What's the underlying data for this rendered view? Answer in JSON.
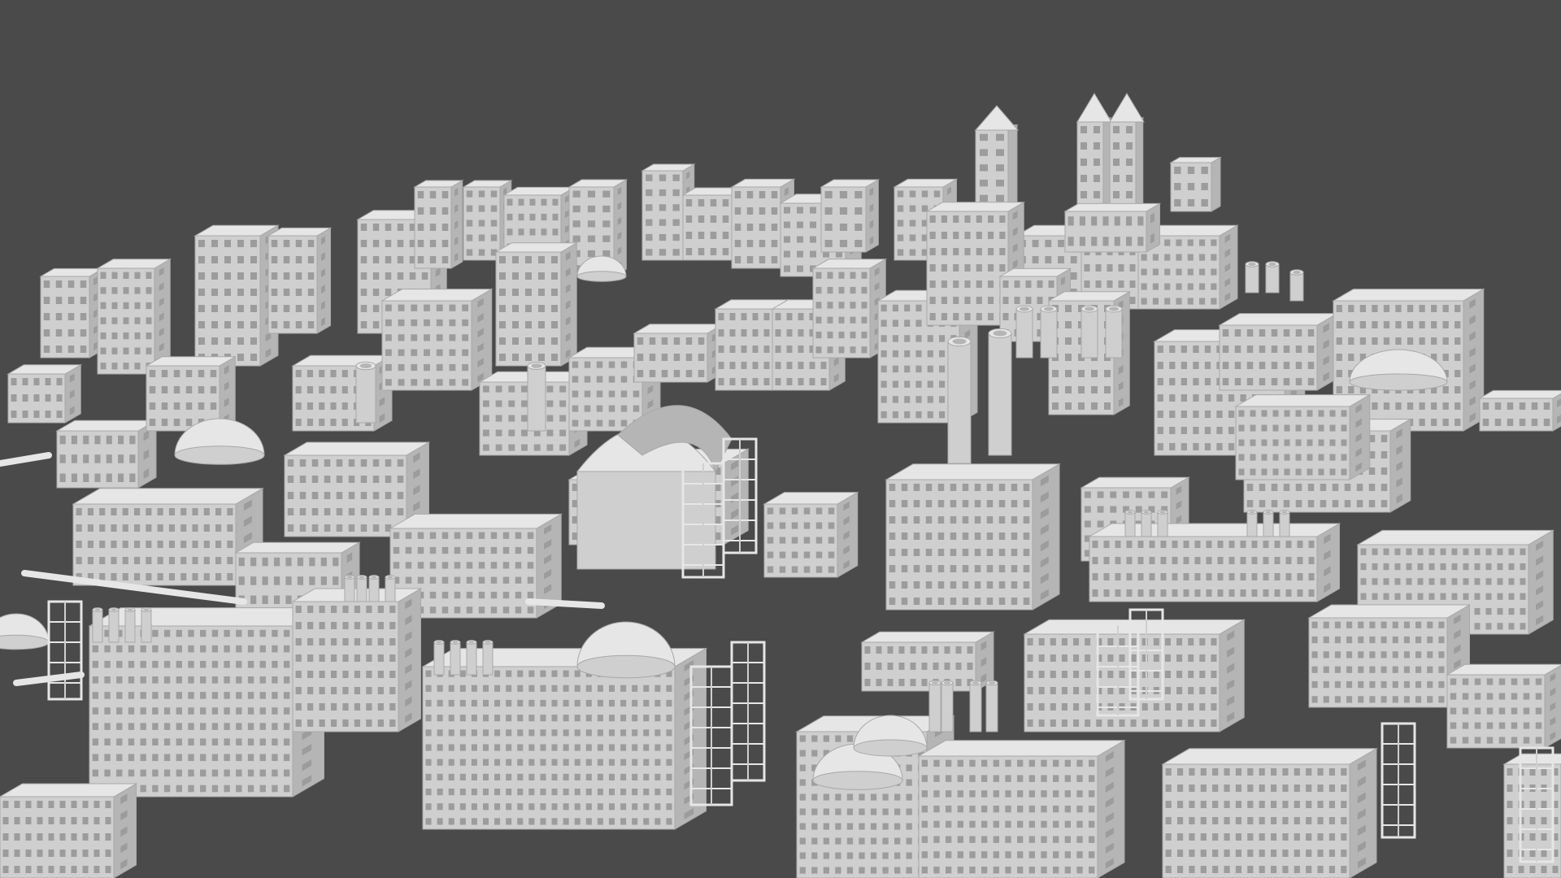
{
  "scene": {
    "subject": "city-model-render",
    "colors": {
      "background": "#4a4a4a",
      "ground": "#474747",
      "building_light": "#e6e6e6",
      "building_mid": "#cfcfcf",
      "building_dark": "#b5b5b5",
      "window": "#9c9c9c",
      "outline": "#a8a8a8"
    }
  }
}
